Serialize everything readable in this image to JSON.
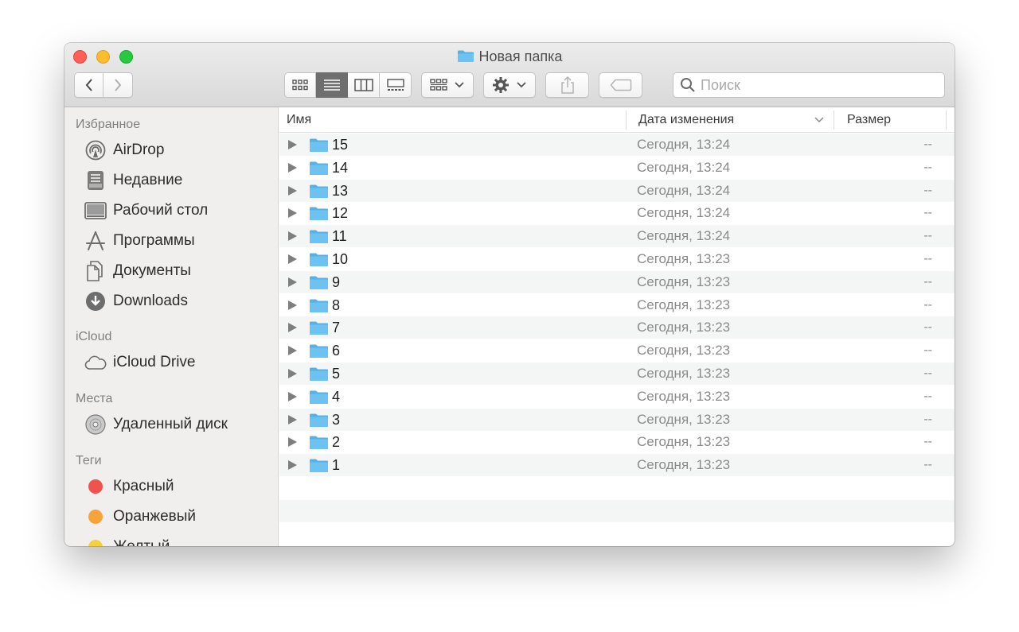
{
  "window": {
    "title": "Новая папка",
    "title_icon": "folder-icon"
  },
  "toolbar": {
    "back_icon": "chevron-left-icon",
    "forward_icon": "chevron-right-icon",
    "views": [
      {
        "name": "icon-view",
        "icon": "grid-icon",
        "active": false
      },
      {
        "name": "list-view",
        "icon": "list-icon",
        "active": true
      },
      {
        "name": "column-view",
        "icon": "columns-icon",
        "active": false
      },
      {
        "name": "gallery-view",
        "icon": "gallery-icon",
        "active": false
      }
    ],
    "group_icon": "group-by-icon",
    "action_icon": "gear-icon",
    "share_icon": "share-icon",
    "tag_icon": "tag-icon",
    "search_placeholder": "Поиск"
  },
  "sidebar": {
    "favorites_title": "Избранное",
    "favorites": [
      {
        "label": "AirDrop",
        "icon": "airdrop-icon"
      },
      {
        "label": "Недавние",
        "icon": "recents-icon"
      },
      {
        "label": "Рабочий стол",
        "icon": "desktop-icon"
      },
      {
        "label": "Программы",
        "icon": "applications-icon"
      },
      {
        "label": "Документы",
        "icon": "documents-icon"
      },
      {
        "label": "Downloads",
        "icon": "downloads-icon"
      }
    ],
    "icloud_title": "iCloud",
    "icloud": [
      {
        "label": "iCloud Drive",
        "icon": "cloud-icon"
      }
    ],
    "places_title": "Места",
    "places": [
      {
        "label": "Удаленный диск",
        "icon": "disc-icon"
      }
    ],
    "tags_title": "Теги",
    "tags": [
      {
        "label": "Красный",
        "color": "#f0534f"
      },
      {
        "label": "Оранжевый",
        "color": "#f6a33a"
      },
      {
        "label": "Желтый",
        "color": "#f5cf3c"
      }
    ]
  },
  "columns": {
    "name": "Имя",
    "date": "Дата изменения",
    "size": "Размер"
  },
  "files": [
    {
      "name": "15",
      "date": "Сегодня, 13:24",
      "size": "--"
    },
    {
      "name": "14",
      "date": "Сегодня, 13:24",
      "size": "--"
    },
    {
      "name": "13",
      "date": "Сегодня, 13:24",
      "size": "--"
    },
    {
      "name": "12",
      "date": "Сегодня, 13:24",
      "size": "--"
    },
    {
      "name": "11",
      "date": "Сегодня, 13:24",
      "size": "--"
    },
    {
      "name": "10",
      "date": "Сегодня, 13:23",
      "size": "--"
    },
    {
      "name": "9",
      "date": "Сегодня, 13:23",
      "size": "--"
    },
    {
      "name": "8",
      "date": "Сегодня, 13:23",
      "size": "--"
    },
    {
      "name": "7",
      "date": "Сегодня, 13:23",
      "size": "--"
    },
    {
      "name": "6",
      "date": "Сегодня, 13:23",
      "size": "--"
    },
    {
      "name": "5",
      "date": "Сегодня, 13:23",
      "size": "--"
    },
    {
      "name": "4",
      "date": "Сегодня, 13:23",
      "size": "--"
    },
    {
      "name": "3",
      "date": "Сегодня, 13:23",
      "size": "--"
    },
    {
      "name": "2",
      "date": "Сегодня, 13:23",
      "size": "--"
    },
    {
      "name": "1",
      "date": "Сегодня, 13:23",
      "size": "--"
    }
  ],
  "colors": {
    "folder": "#6cc3f2",
    "folder_tab": "#56b2e6",
    "close": "#fe5f57",
    "minimize": "#febc2e",
    "maximize": "#28c840"
  }
}
